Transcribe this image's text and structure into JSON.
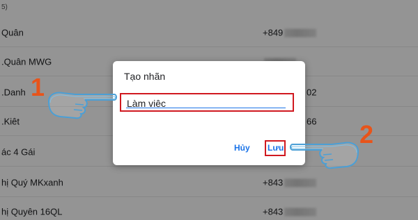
{
  "header": {
    "text": "5)"
  },
  "contacts": [
    {
      "name": "Quân",
      "phone_prefix": "+849",
      "phone_tail": ""
    },
    {
      "name": ".Quân MWG",
      "phone_prefix": "",
      "phone_tail": ""
    },
    {
      "name": ".Danh",
      "phone_prefix": "",
      "phone_tail": "02"
    },
    {
      "name": ".Kiêt",
      "phone_prefix": "",
      "phone_tail": "66"
    },
    {
      "name": "ác 4 Gái",
      "phone_prefix": "",
      "phone_tail": ""
    },
    {
      "name": "hị Quý MKxanh",
      "phone_prefix": "+843",
      "phone_tail": ""
    },
    {
      "name": "hị Quyên 16QL",
      "phone_prefix": "+843",
      "phone_tail": ""
    }
  ],
  "dialog": {
    "title": "Tạo nhãn",
    "input_value": "Làm việc",
    "cancel_label": "Hủy",
    "save_label": "Lưu"
  },
  "annotations": {
    "step1": "1",
    "step2": "2"
  },
  "colors": {
    "highlight_red": "#d0181f",
    "step_orange": "#e8541a",
    "link_blue": "#1a73e8"
  },
  "icons": {
    "pointer1": "pointing-hand-icon",
    "pointer2": "pointing-hand-icon"
  }
}
